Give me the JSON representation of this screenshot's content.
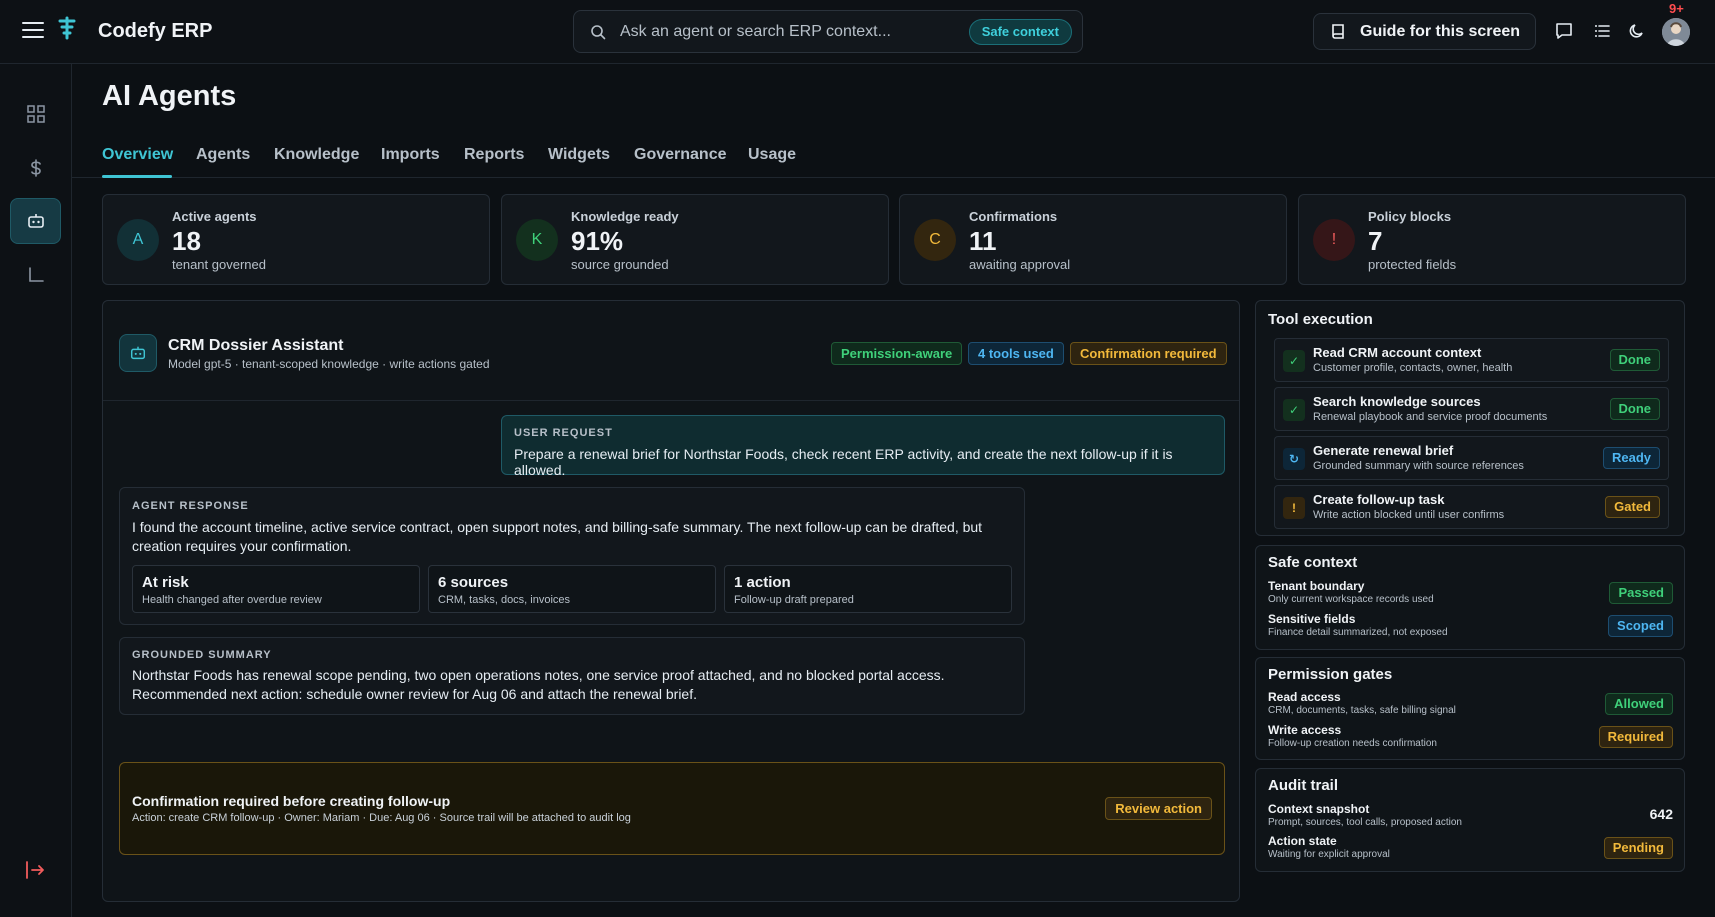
{
  "app": {
    "brand": "Codefy ERP",
    "notifications": "9+"
  },
  "search": {
    "placeholder": "Ask an agent or search ERP context...",
    "pill": "Safe context"
  },
  "header": {
    "guide_label": "Guide for this screen"
  },
  "page": {
    "title": "AI Agents"
  },
  "tabs": [
    {
      "label": "Overview",
      "active": true
    },
    {
      "label": "Agents"
    },
    {
      "label": "Knowledge"
    },
    {
      "label": "Imports"
    },
    {
      "label": "Reports"
    },
    {
      "label": "Widgets"
    },
    {
      "label": "Governance"
    },
    {
      "label": "Usage"
    }
  ],
  "stats": [
    {
      "letter": "A",
      "label": "Active agents",
      "value": "18",
      "sub": "tenant governed",
      "color": "#3fc5d4"
    },
    {
      "letter": "K",
      "label": "Knowledge ready",
      "value": "91%",
      "sub": "source grounded",
      "color": "#3fd07a"
    },
    {
      "letter": "C",
      "label": "Confirmations",
      "value": "11",
      "sub": "awaiting approval",
      "color": "#f2b93b"
    },
    {
      "letter": "!",
      "label": "Policy blocks",
      "value": "7",
      "sub": "protected fields",
      "color": "#f25c5c"
    }
  ],
  "assistant": {
    "name": "CRM Dossier Assistant",
    "meta": "Model gpt-5 · tenant-scoped knowledge · write actions gated",
    "tags": [
      "Permission-aware",
      "4 tools used",
      "Confirmation required"
    ],
    "user_request_label": "USER REQUEST",
    "user_request": "Prepare a renewal brief for Northstar Foods, check recent ERP activity, and create the next follow-up if it is allowed.",
    "agent_response_label": "AGENT RESPONSE",
    "agent_response": "I found the account timeline, active service contract, open support notes, and billing-safe summary. The next follow-up can be drafted, but creation requires your confirmation.",
    "highlights": [
      {
        "title": "At risk",
        "sub": "Health changed after overdue review"
      },
      {
        "title": "6 sources",
        "sub": "CRM, tasks, docs, invoices"
      },
      {
        "title": "1 action",
        "sub": "Follow-up draft prepared"
      }
    ],
    "grounded_label": "GROUNDED SUMMARY",
    "grounded_summary_1": "Northstar Foods has renewal scope pending, two open operations notes, one service proof attached, and no blocked portal access.",
    "grounded_summary_2": "Recommended next action: schedule owner review for Aug 06 and attach the renewal brief.",
    "confirm_title": "Confirmation required before creating follow-up",
    "confirm_sub": "Action: create CRM follow-up · Owner: Mariam · Due: Aug 06 · Source trail will be attached to audit log",
    "confirm_button": "Review action"
  },
  "tool_execution": {
    "title": "Tool execution",
    "items": [
      {
        "title": "Read CRM account context",
        "sub": "Customer profile, contacts, owner, health",
        "status": "Done",
        "icon": "check-icon"
      },
      {
        "title": "Search knowledge sources",
        "sub": "Renewal playbook and service proof documents",
        "status": "Done",
        "icon": "check-icon"
      },
      {
        "title": "Generate renewal brief",
        "sub": "Grounded summary with source references",
        "status": "Ready",
        "icon": "refresh-icon"
      },
      {
        "title": "Create follow-up task",
        "sub": "Write action blocked until user confirms",
        "status": "Gated",
        "icon": "warning-icon"
      }
    ]
  },
  "safe_context": {
    "title": "Safe context",
    "items": [
      {
        "title": "Tenant boundary",
        "sub": "Only current workspace records used",
        "status": "Passed"
      },
      {
        "title": "Sensitive fields",
        "sub": "Finance detail summarized, not exposed",
        "status": "Scoped"
      }
    ]
  },
  "permission_gates": {
    "title": "Permission gates",
    "items": [
      {
        "title": "Read access",
        "sub": "CRM, documents, tasks, safe billing signal",
        "status": "Allowed"
      },
      {
        "title": "Write access",
        "sub": "Follow-up creation needs confirmation",
        "status": "Required"
      }
    ]
  },
  "audit_trail": {
    "title": "Audit trail",
    "items": [
      {
        "title": "Context snapshot",
        "sub": "Prompt, sources, tool calls, proposed action",
        "value": "642"
      },
      {
        "title": "Action state",
        "sub": "Waiting for explicit approval",
        "status": "Pending"
      }
    ]
  },
  "colors": {
    "accent": "#3fc5d4",
    "success": "#3fd07a",
    "info": "#4eb6f2",
    "warning": "#f2b93b",
    "danger": "#f25c5c"
  }
}
